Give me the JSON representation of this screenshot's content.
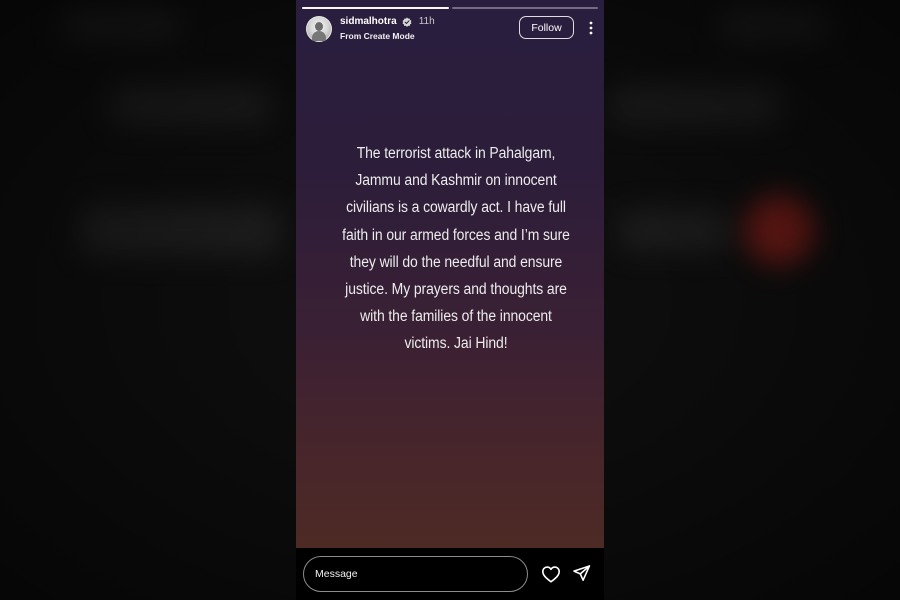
{
  "story": {
    "username": "sidmalhotra",
    "time_ago": "11h",
    "subtitle": "From Create Mode",
    "follow_label": "Follow",
    "text": "The terrorist attack in Pahalgam, Jammu and Kashmir on innocent civilians is a cowardly act. I have full faith in our armed forces and I’m sure they will do the needful and ensure justice. My prayers and thoughts are with the families of the innocent victims. Jai Hind!",
    "progress": [
      1.0,
      0.0
    ],
    "icons": {
      "verified": "verified-badge-icon",
      "more": "more-options-icon",
      "avatar": "profile-avatar"
    }
  },
  "reply_bar": {
    "placeholder": "Message",
    "icons": {
      "like": "heart-icon",
      "share": "send-icon"
    }
  },
  "colors": {
    "background": "#0d0d0d",
    "story_gradient_top": "#2a1e3f",
    "story_gradient_bottom": "#4e2a25",
    "text": "#ececec"
  }
}
